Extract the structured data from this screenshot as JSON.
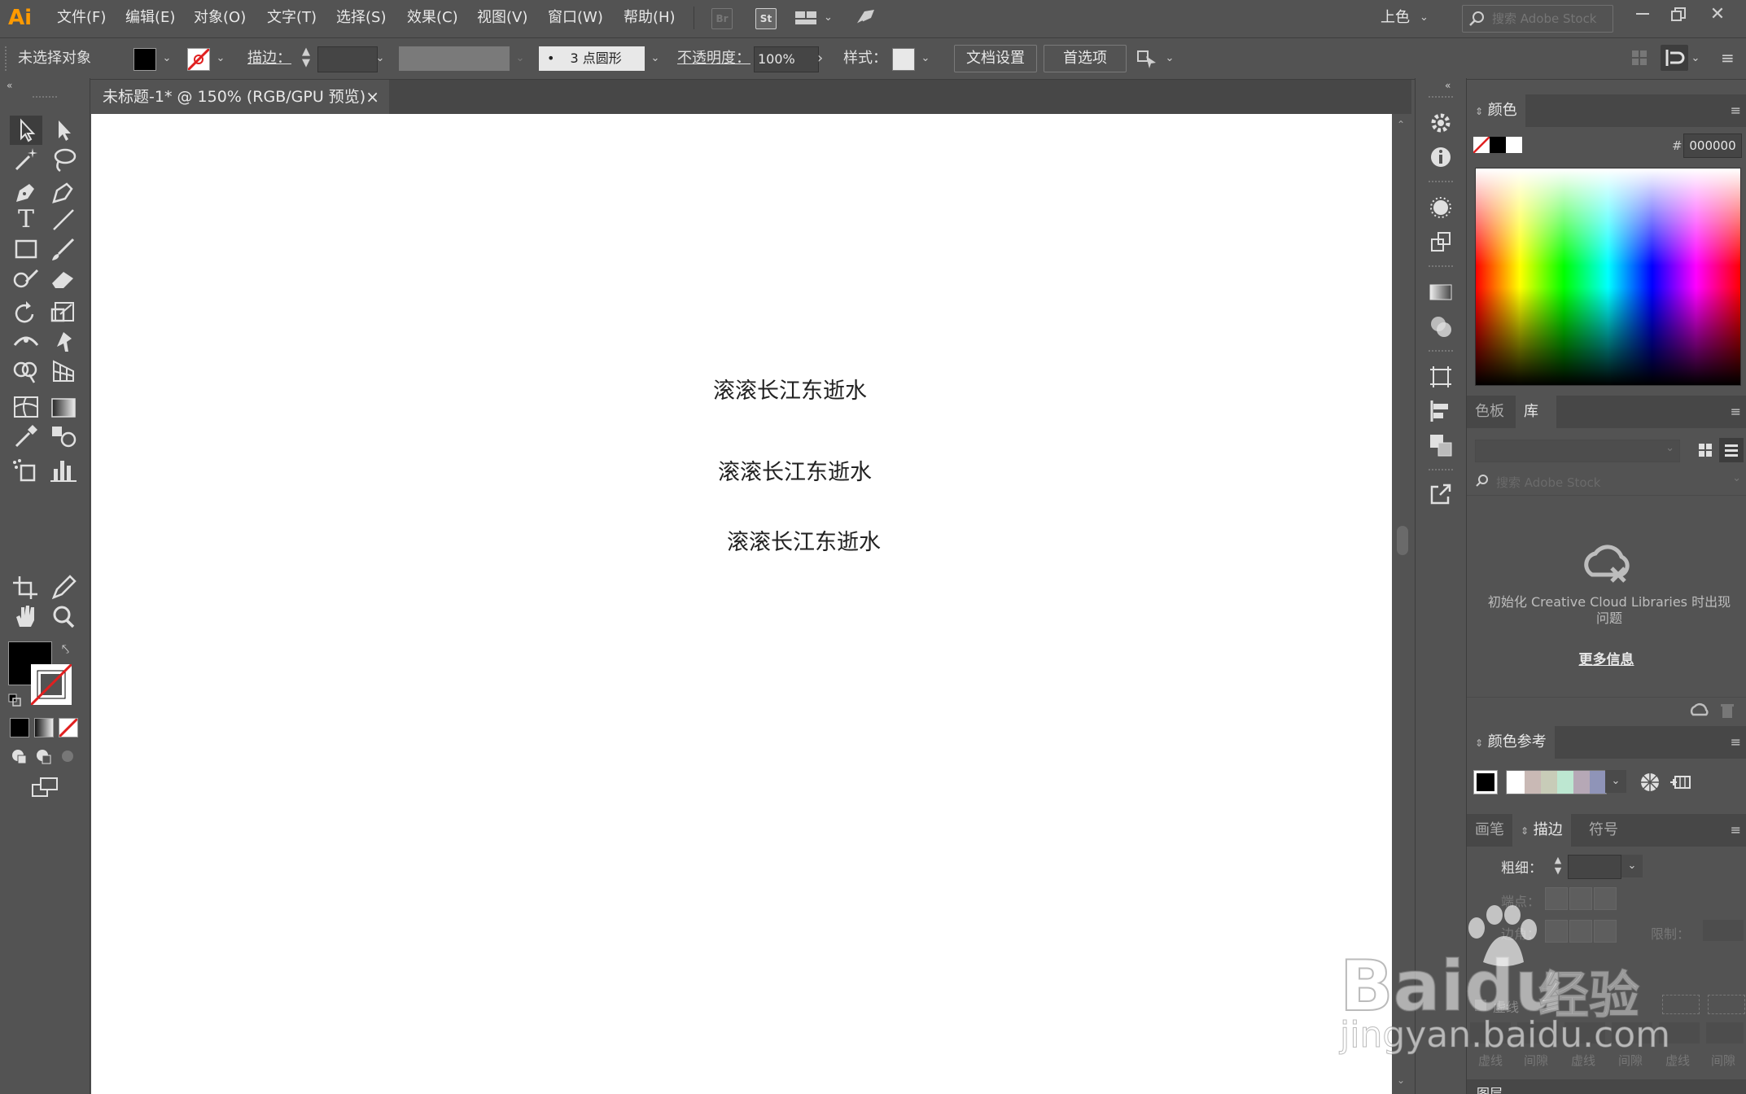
{
  "app": {
    "logo": "Ai",
    "menus": [
      "文件(F)",
      "编辑(E)",
      "对象(O)",
      "文字(T)",
      "选择(S)",
      "效果(C)",
      "视图(V)",
      "窗口(W)",
      "帮助(H)"
    ],
    "bridge_label": "Br",
    "stock_label": "St",
    "workspace": "上色",
    "search_placeholder": "搜索 Adobe Stock",
    "accent_color": "#ff9a00"
  },
  "control_bar": {
    "selection_status": "未选择对象",
    "stroke_label": "描边：",
    "brush_label": "3 点圆形",
    "opacity_label": "不透明度：",
    "opacity_value": "100%",
    "style_label": "样式：",
    "doc_setup_button": "文档设置",
    "preferences_button": "首选项"
  },
  "document": {
    "tab_title": "未标题-1* @ 150% (RGB/GPU 预览)",
    "close_glyph": "×",
    "text_lines": [
      "滚滚长江东逝水",
      "滚滚长江东逝水",
      "滚滚长江东逝水"
    ]
  },
  "color_panel": {
    "title": "颜色",
    "hex_label": "#",
    "hex_value": "000000"
  },
  "library_panel": {
    "tabs": [
      "色板",
      "库"
    ],
    "search_placeholder": "搜索 Adobe Stock",
    "error_message": "初始化 Creative Cloud Libraries 时出现问题",
    "more_info_link": "更多信息"
  },
  "color_guide_panel": {
    "title": "颜色参考",
    "harmony_colors": [
      "#ffffff",
      "#c9b9b5",
      "#c8ccb8",
      "#bde7d1",
      "#b6a8b6",
      "#8f94b8"
    ]
  },
  "stroke_panel": {
    "tabs": [
      "画笔",
      "描边",
      "符号"
    ],
    "weight_label": "粗细：",
    "cap_label": "端点：",
    "corner_label": "边角：",
    "limit_label": "限制：",
    "dashed_label": "虚线",
    "dash_labels": [
      "虚线",
      "间隙",
      "虚线",
      "间隙",
      "虚线",
      "间隙"
    ]
  },
  "layers_panel": {
    "title": "图层"
  },
  "watermark": {
    "brand": "Baidu",
    "label": "经验",
    "url": "jingyan.baidu.com"
  }
}
